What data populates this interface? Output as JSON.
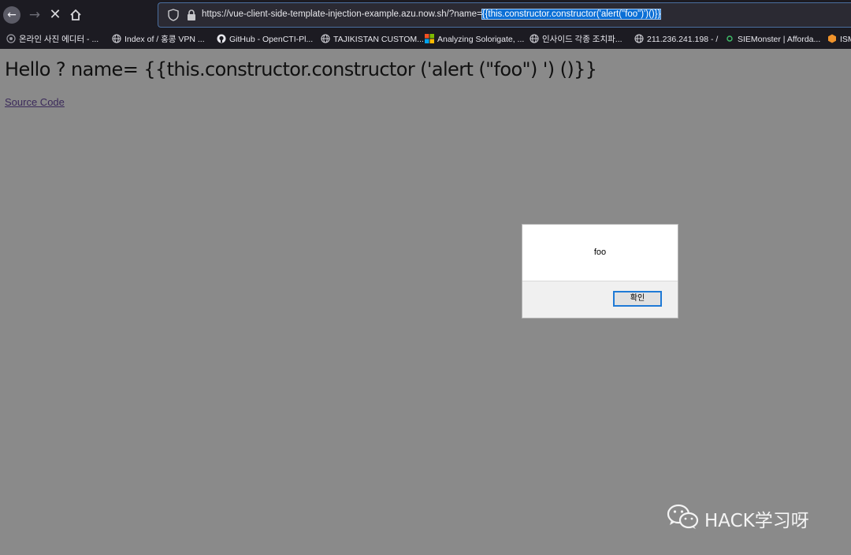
{
  "browser": {
    "url_prefix": "https://vue-client-side-template-injection-example.azu.now.sh/?name=",
    "url_selected": "{{this.constructor.constructor('alert(\"foo\")')()}}",
    "icons": [
      "back-arrow-icon",
      "forward-arrow-icon",
      "stop-icon",
      "home-icon",
      "shield-icon",
      "lock-icon"
    ]
  },
  "bookmarks": [
    {
      "label": "온라인 사진 에디터 - ...",
      "icon": "bookmark-generic-icon"
    },
    {
      "label": "Index of / 홍콩 VPN ...",
      "icon": "globe-icon"
    },
    {
      "label": "GitHub - OpenCTI-Pl...",
      "icon": "github-icon"
    },
    {
      "label": "TAJIKISTAN CUSTOM...",
      "icon": "globe-icon"
    },
    {
      "label": "Analyzing Solorigate, ...",
      "icon": "microsoft-icon"
    },
    {
      "label": "인사이드 각종 조치파...",
      "icon": "globe-icon"
    },
    {
      "label": "211.236.241.198 - /",
      "icon": "globe-icon"
    },
    {
      "label": "SIEMonster | Afforda...",
      "icon": "siemonster-icon"
    },
    {
      "label": "ISM",
      "icon": "hex-icon"
    }
  ],
  "page": {
    "heading": "Hello ? name= {{this.constructor.constructor ('alert (\"foo\") ') ()}}",
    "source_link": "Source Code"
  },
  "alert": {
    "message": "foo",
    "ok_label": "확인"
  },
  "watermark": {
    "text": "HACK学习呀",
    "icon": "wechat-icon"
  },
  "colors": {
    "toolbar_bg": "#1c1b22",
    "page_bg": "#8a8a8a",
    "url_selection": "#0b6fd6"
  }
}
